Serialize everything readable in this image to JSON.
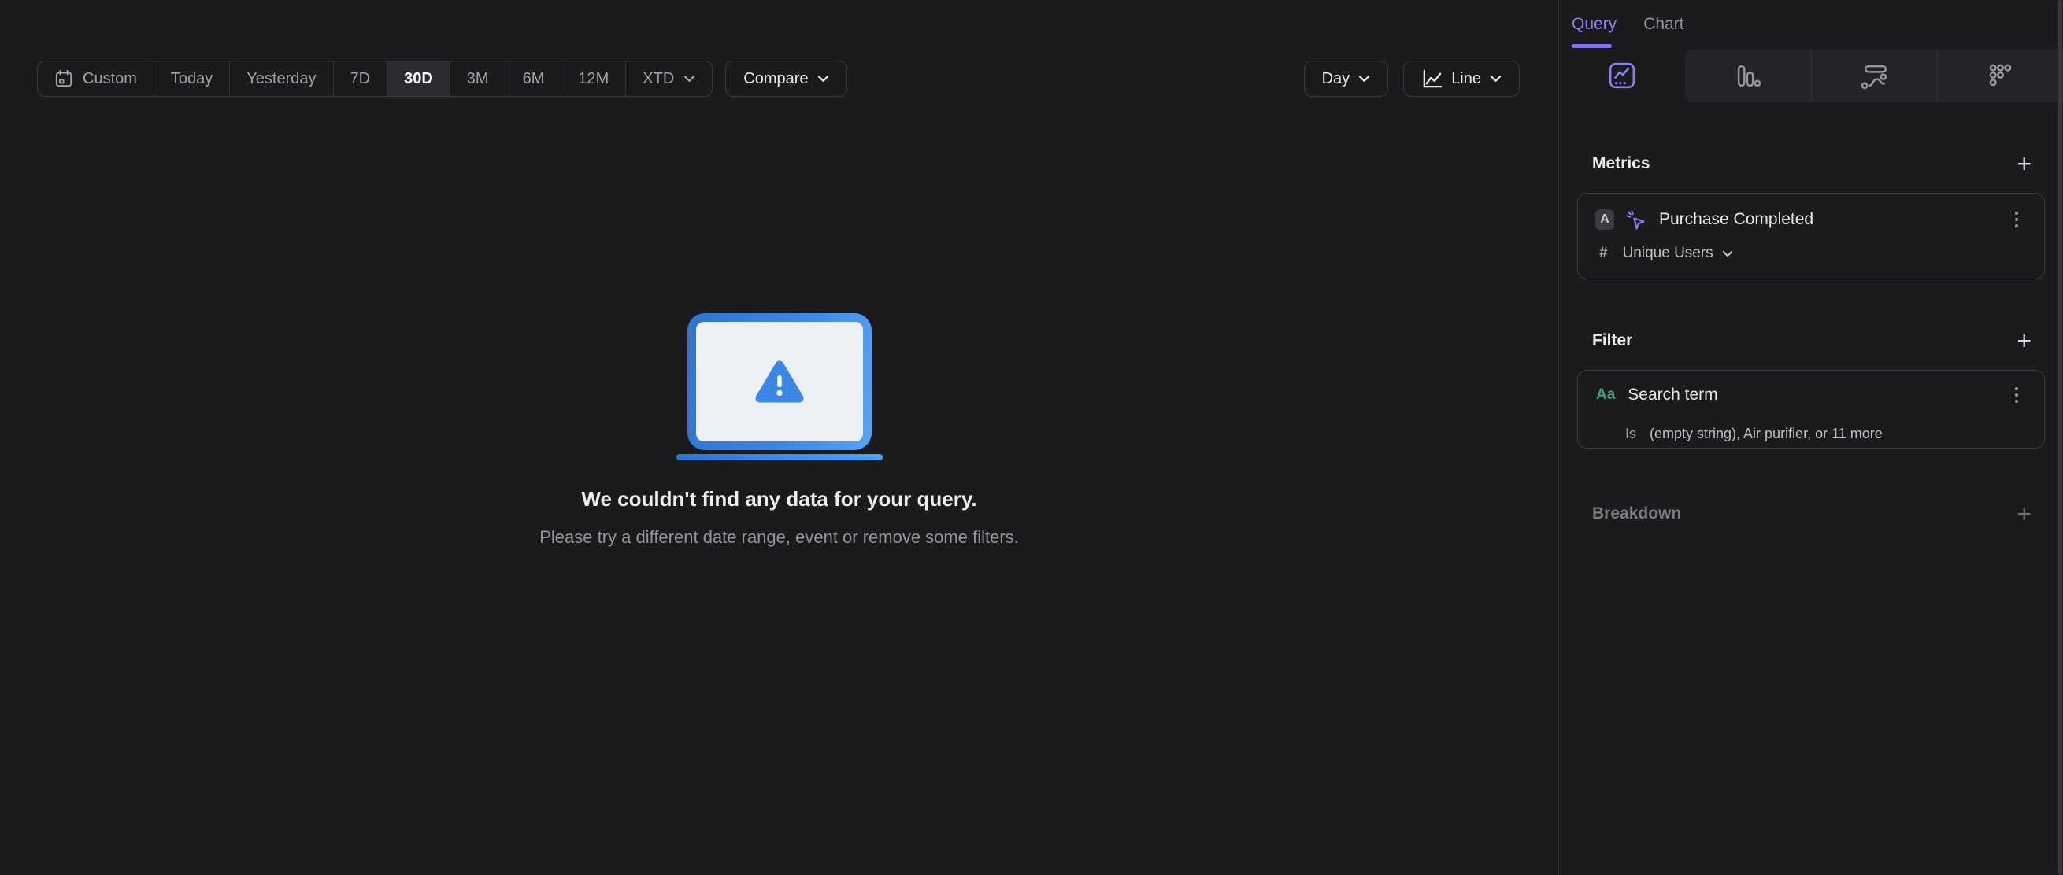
{
  "toolbar": {
    "date_ranges": [
      {
        "label": "Custom",
        "selected": false,
        "icon": "calendar"
      },
      {
        "label": "Today",
        "selected": false
      },
      {
        "label": "Yesterday",
        "selected": false
      },
      {
        "label": "7D",
        "selected": false
      },
      {
        "label": "30D",
        "selected": true
      },
      {
        "label": "3M",
        "selected": false
      },
      {
        "label": "6M",
        "selected": false
      },
      {
        "label": "12M",
        "selected": false
      },
      {
        "label": "XTD",
        "selected": false,
        "has_chevron": true
      }
    ],
    "compare_label": "Compare",
    "granularity_label": "Day",
    "chart_style_label": "Line"
  },
  "empty_state": {
    "title": "We couldn't find any data for your query.",
    "subtitle": "Please try a different date range, event or remove some filters."
  },
  "sidebar": {
    "tabs": [
      {
        "label": "Query",
        "active": true
      },
      {
        "label": "Chart",
        "active": false
      }
    ],
    "chart_type_tabs": [
      {
        "name": "insights-line",
        "active": true
      },
      {
        "name": "bar",
        "active": false
      },
      {
        "name": "flow",
        "active": false
      },
      {
        "name": "retention",
        "active": false
      }
    ],
    "metrics": {
      "title": "Metrics",
      "items": [
        {
          "series_letter": "A",
          "event_icon": "click-event",
          "event_name": "Purchase Completed",
          "aggregation_prefix": "#",
          "aggregation_label": "Unique Users"
        }
      ]
    },
    "filter": {
      "title": "Filter",
      "items": [
        {
          "type_badge": "Aa",
          "property_name": "Search term",
          "operator": "Is",
          "values_summary": "(empty string), Air purifier, or 11 more"
        }
      ]
    },
    "breakdown": {
      "title": "Breakdown"
    }
  },
  "icons": {
    "add": "+"
  },
  "colors": {
    "background": "#1b1b1d",
    "panel_raised": "#232428",
    "selected_segment": "#2b2c30",
    "accent_purple": "#8a7ff2",
    "accent_green": "#41a378",
    "accent_blue": "#3b87e6"
  }
}
